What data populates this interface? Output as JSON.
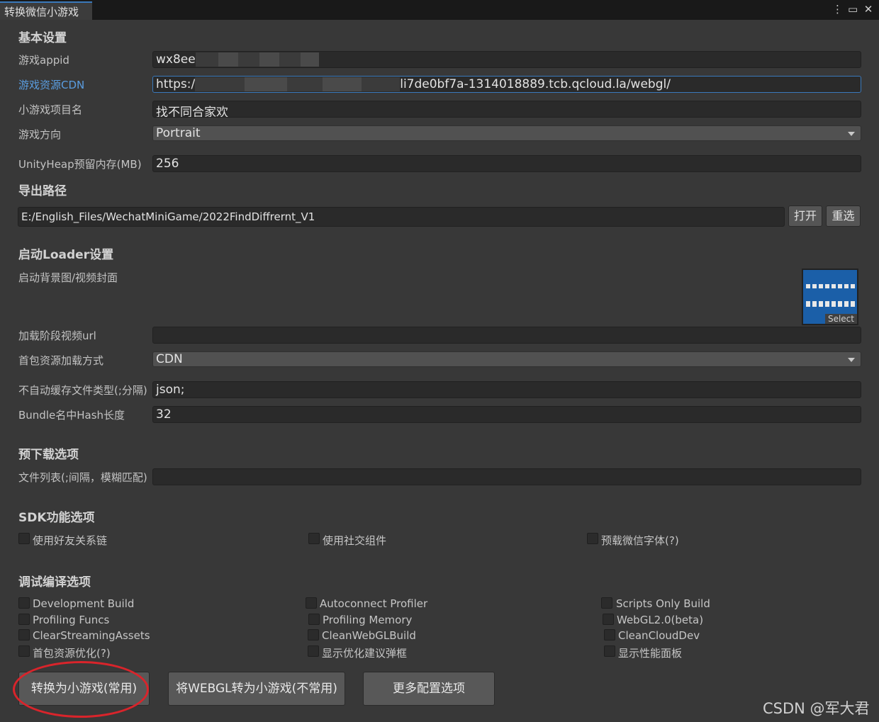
{
  "window": {
    "tab_title": "转换微信小游戏",
    "icons": [
      "more-icon",
      "maximize-icon",
      "close-icon"
    ]
  },
  "basic": {
    "heading": "基本设置",
    "appid_label": "游戏appid",
    "appid_value": "wx8ee",
    "cdn_label": "游戏资源CDN",
    "cdn_prefix": "https:/",
    "cdn_suffix": "li7de0bf7a-1314018889.tcb.qcloud.la/webgl/",
    "project_label": "小游戏项目名",
    "project_value": "找不同合家欢",
    "orientation_label": "游戏方向",
    "orientation_value": "Portrait",
    "heap_label": "UnityHeap预留内存(MB)",
    "heap_value": "256"
  },
  "export": {
    "heading": "导出路径",
    "path_value": "E:/English_Files/WechatMiniGame/2022FindDiffrernt_V1",
    "open_label": "打开",
    "reselect_label": "重选"
  },
  "loader": {
    "heading": "启动Loader设置",
    "bg_label": "启动背景图/视频封面",
    "select_label": "Select",
    "video_label": "加载阶段视频url",
    "video_value": "",
    "load_mode_label": "首包资源加载方式",
    "load_mode_value": "CDN",
    "nocache_label": "不自动缓存文件类型(;分隔)",
    "nocache_value": "json;",
    "hash_label": "Bundle名中Hash长度",
    "hash_value": "32"
  },
  "preload": {
    "heading": "预下载选项",
    "files_label": "文件列表(;间隔，模糊匹配)",
    "files_value": ""
  },
  "sdk": {
    "heading": "SDK功能选项",
    "options": [
      "使用好友关系链",
      "使用社交组件",
      "预载微信字体(?)"
    ]
  },
  "debug": {
    "heading": "调试编译选项",
    "col1": [
      "Development Build",
      "Profiling Funcs",
      "ClearStreamingAssets",
      "首包资源优化(?)"
    ],
    "col2": [
      "Autoconnect Profiler",
      "Profiling Memory",
      "CleanWebGLBuild",
      "显示优化建议弹框"
    ],
    "col3": [
      "Scripts Only Build",
      "WebGL2.0(beta)",
      "CleanCloudDev",
      "显示性能面板"
    ]
  },
  "actions": {
    "convert_label": "转换为小游戏(常用)",
    "webgl_label": "将WEBGL转为小游戏(不常用)",
    "more_label": "更多配置选项"
  },
  "watermark": "CSDN @军大君",
  "colors": {
    "background": "#383838",
    "focus": "#3a79bb",
    "link": "#5a9de0",
    "highlight": "#d9242b"
  }
}
